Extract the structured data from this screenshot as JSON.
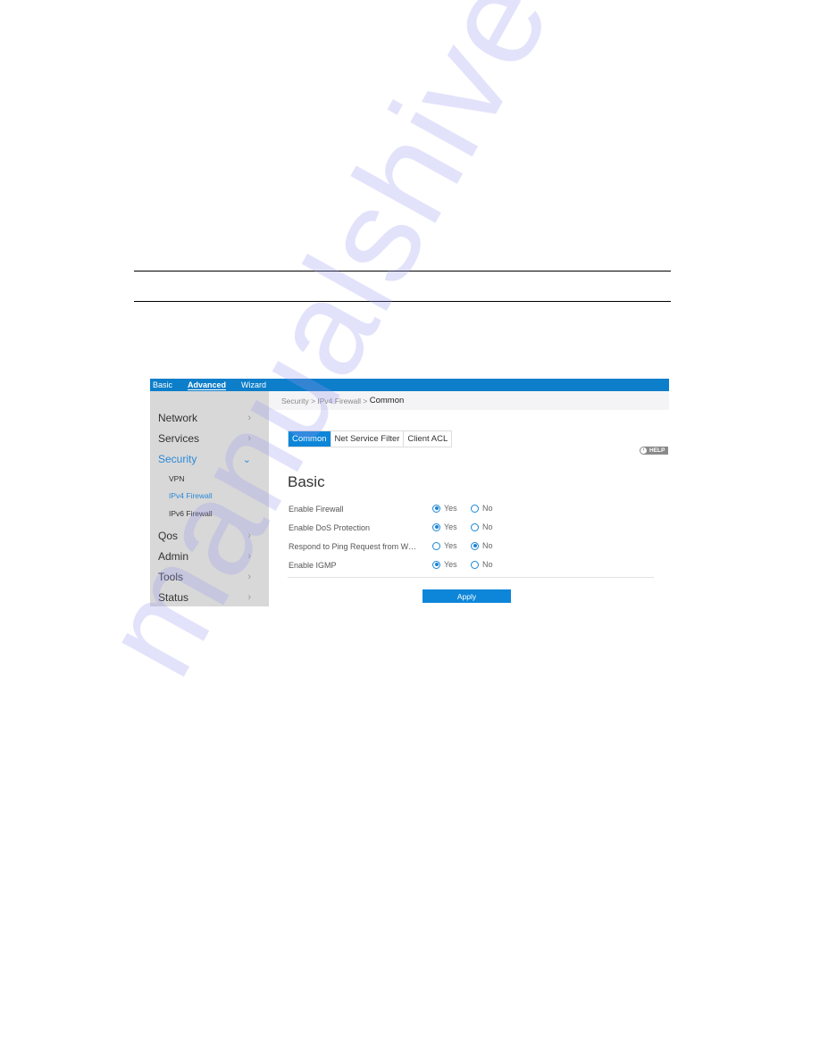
{
  "watermark": "manualshive",
  "router_ui": {
    "top_nav": [
      {
        "label": "Basic",
        "active": false
      },
      {
        "label": "Advanced",
        "active": true
      },
      {
        "label": "Wizard",
        "active": false
      }
    ],
    "sidebar": {
      "items": [
        {
          "label": "Network",
          "chevron": ">"
        },
        {
          "label": "Services",
          "chevron": ">"
        },
        {
          "label": "Security",
          "chevron": "v",
          "expanded": true
        },
        {
          "label": "Qos",
          "chevron": ">"
        },
        {
          "label": "Admin",
          "chevron": ">"
        },
        {
          "label": "Tools",
          "chevron": ">"
        },
        {
          "label": "Status",
          "chevron": ">"
        }
      ],
      "security_subitems": [
        {
          "label": "VPN",
          "active": false
        },
        {
          "label": "IPv4 Firewall",
          "active": true
        },
        {
          "label": "IPv6 Firewall",
          "active": false
        }
      ]
    },
    "breadcrumb": {
      "parts": [
        "Security",
        "IPv4 Firewall"
      ],
      "separator": " > ",
      "current": "Common"
    },
    "tabs": [
      {
        "label": "Common",
        "active": true
      },
      {
        "label": "Net Service Filter",
        "active": false
      },
      {
        "label": "Client ACL",
        "active": false
      }
    ],
    "help_label": "HELP",
    "section_title": "Basic",
    "settings": [
      {
        "label": "Enable Firewall",
        "value": "Yes"
      },
      {
        "label": "Enable DoS Protection",
        "value": "Yes"
      },
      {
        "label": "Respond to Ping Request from W…",
        "value": "No"
      },
      {
        "label": "Enable IGMP",
        "value": "Yes"
      }
    ],
    "option_yes": "Yes",
    "option_no": "No",
    "apply_label": "Apply",
    "colors": {
      "accent": "#0d86d9",
      "sidebar_bg": "#d8d8d8",
      "active_link": "#2b8ad8"
    }
  }
}
